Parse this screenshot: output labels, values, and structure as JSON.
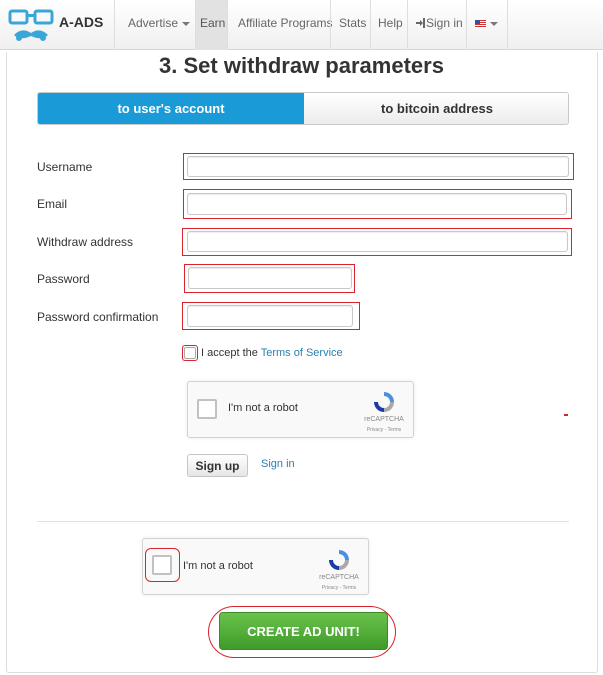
{
  "navbar": {
    "brand": "A-ADS",
    "items": [
      {
        "label": "Advertise",
        "dropdown": true
      },
      {
        "label": "Earn",
        "active": true
      },
      {
        "label": "Affiliate Programs"
      },
      {
        "label": "Stats"
      },
      {
        "label": "Help"
      },
      {
        "label": "Sign in",
        "icon": "sign-in-icon"
      }
    ],
    "language_icon": "us-flag-icon"
  },
  "form": {
    "title": "3. Set withdraw parameters",
    "toggle": {
      "selected": "to user's account",
      "other": "to bitcoin address"
    },
    "fields": {
      "username": {
        "label": "Username",
        "value": ""
      },
      "email": {
        "label": "Email",
        "value": ""
      },
      "withdraw_address": {
        "label": "Withdraw address",
        "value": ""
      },
      "password": {
        "label": "Password",
        "value": ""
      },
      "password_confirmation": {
        "label": "Password confirmation",
        "value": ""
      }
    },
    "terms": {
      "prefix": "I accept the",
      "link": "Terms of Service",
      "checked": false
    },
    "captcha": {
      "label": "I'm not a robot",
      "brand": "reCAPTCHA",
      "footer": "Privacy - Terms"
    },
    "signup_label": "Sign up",
    "signin_label": "Sign in"
  },
  "bottom": {
    "captcha": {
      "label": "I'm not a robot",
      "brand": "reCAPTCHA",
      "footer": "Privacy - Terms"
    },
    "create_label": "CREATE AD UNIT!"
  },
  "colors": {
    "accent": "#1a9bd7",
    "highlight": "#d9232d",
    "create_button": "#4caf37",
    "link": "#2a7fb0"
  }
}
